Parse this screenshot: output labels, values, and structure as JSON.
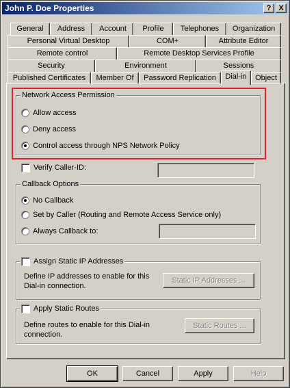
{
  "window": {
    "title": "John P. Doe Properties"
  },
  "titlebar_buttons": {
    "help": "?",
    "close": "X"
  },
  "tabs": {
    "row1": [
      "General",
      "Address",
      "Account",
      "Profile",
      "Telephones",
      "Organization"
    ],
    "row2": [
      "Personal Virtual Desktop",
      "COM+",
      "Attribute Editor"
    ],
    "row3": [
      "Remote control",
      "Remote Desktop Services Profile"
    ],
    "row4": [
      "Security",
      "Environment",
      "Sessions"
    ],
    "row5": [
      "Published Certificates",
      "Member Of",
      "Password Replication",
      "Dial-in",
      "Object"
    ],
    "active": "Dial-in"
  },
  "network_access": {
    "legend": "Network Access Permission",
    "options": [
      "Allow access",
      "Deny access",
      "Control access through NPS Network Policy"
    ],
    "selected": "Control access through NPS Network Policy"
  },
  "verify_caller_id": {
    "label": "Verify Caller-ID:",
    "value": ""
  },
  "callback": {
    "legend": "Callback Options",
    "options": [
      "No Callback",
      "Set by Caller (Routing and Remote Access Service only)",
      "Always Callback to:"
    ],
    "selected": "No Callback",
    "callback_number": ""
  },
  "static_ip": {
    "label": "Assign Static IP Addresses",
    "description": [
      "Define IP addresses to enable for this",
      "Dial-in connection."
    ],
    "button": "Static IP Addresses ..."
  },
  "static_routes": {
    "label": "Apply Static Routes",
    "description": [
      "Define routes to enable for this Dial-in",
      "connection."
    ],
    "button": "Static Routes ..."
  },
  "footer": {
    "ok": "OK",
    "cancel": "Cancel",
    "apply": "Apply",
    "help": "Help"
  },
  "colors": {
    "title_start": "#0a246a",
    "title_end": "#a6caf0",
    "highlight": "#e0202a",
    "face": "#d4d0c8"
  }
}
